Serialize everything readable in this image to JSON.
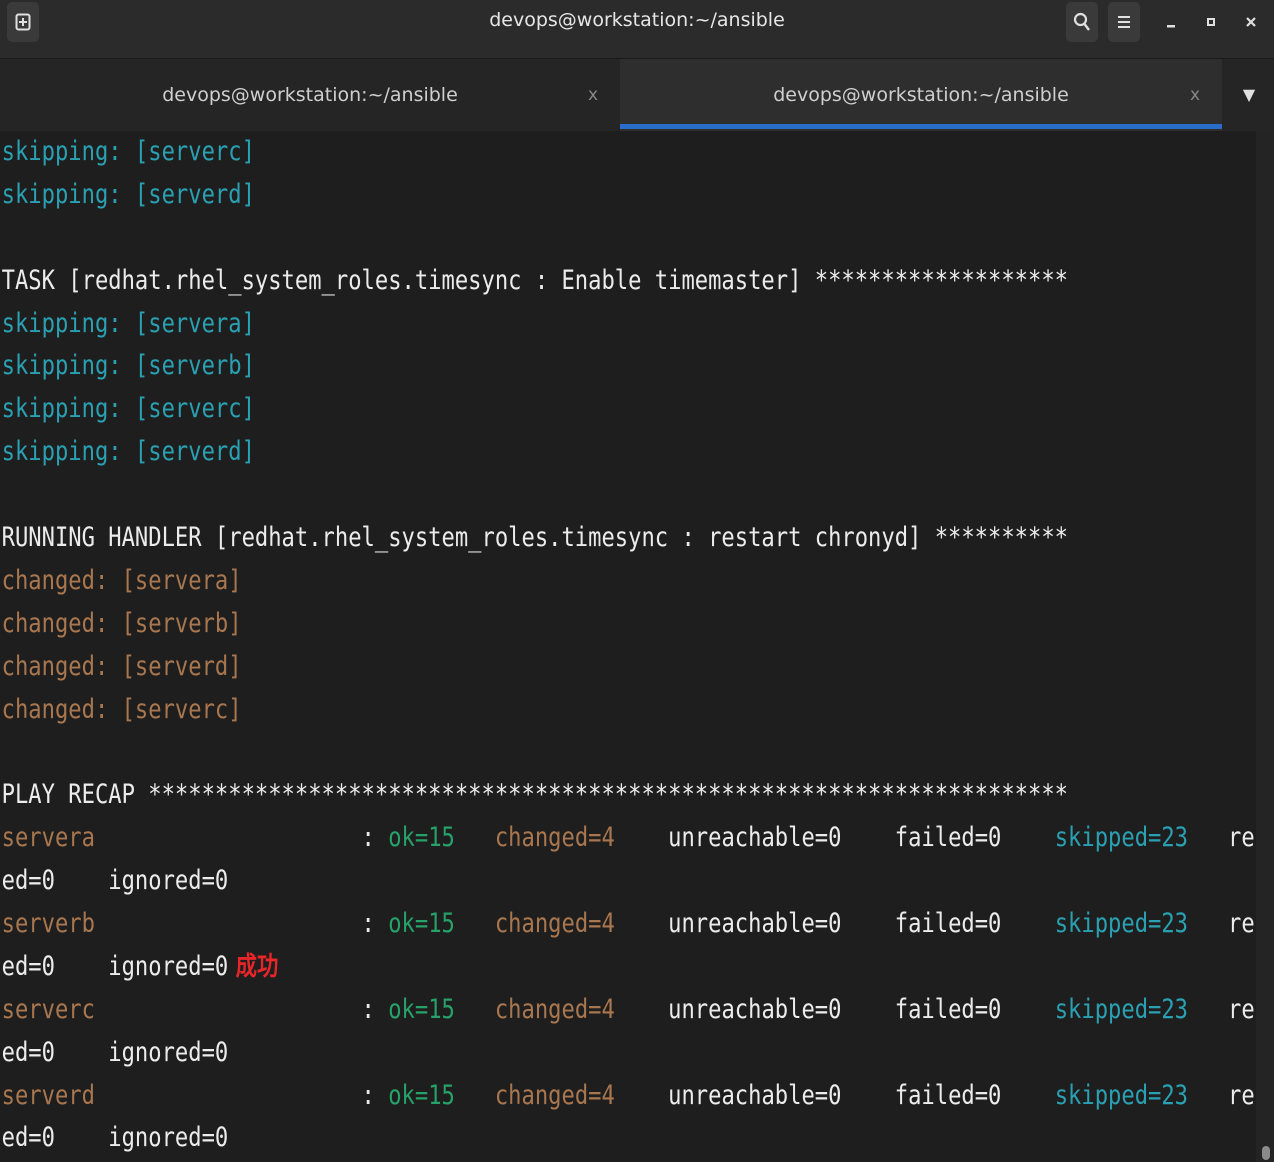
{
  "window": {
    "title": "devops@workstation:~/ansible"
  },
  "tabs": [
    {
      "label": "devops@workstation:~/ansible",
      "close": "x",
      "active": false
    },
    {
      "label": "devops@workstation:~/ansible",
      "close": "x",
      "active": true
    }
  ],
  "icons": {
    "new_tab": "new-tab-icon",
    "search": "search-icon",
    "menu": "hamburger-menu-icon",
    "minimize": "minimize-icon",
    "maximize": "maximize-icon",
    "close": "close-icon",
    "tab_list": "chevron-down-icon"
  },
  "colors": {
    "skipped": "#2aa1b3",
    "changed": "#a9774f",
    "ok": "#26a269",
    "annotation": "#e8262a",
    "active_tab_underline": "#2a6cc9"
  },
  "terminal": {
    "lines": [
      [
        {
          "t": "skipping: [serverc]",
          "c": "cyan"
        }
      ],
      [
        {
          "t": "skipping: [serverd]",
          "c": "cyan"
        }
      ],
      [],
      [
        {
          "t": "TASK [redhat.rhel_system_roles.timesync : Enable timemaster] *******************",
          "c": "white"
        }
      ],
      [
        {
          "t": "skipping: [servera]",
          "c": "cyan"
        }
      ],
      [
        {
          "t": "skipping: [serverb]",
          "c": "cyan"
        }
      ],
      [
        {
          "t": "skipping: [serverc]",
          "c": "cyan"
        }
      ],
      [
        {
          "t": "skipping: [serverd]",
          "c": "cyan"
        }
      ],
      [],
      [
        {
          "t": "RUNNING HANDLER [redhat.rhel_system_roles.timesync : restart chronyd] **********",
          "c": "white"
        }
      ],
      [
        {
          "t": "changed: [servera]",
          "c": "brown"
        }
      ],
      [
        {
          "t": "changed: [serverb]",
          "c": "brown"
        }
      ],
      [
        {
          "t": "changed: [serverd]",
          "c": "brown"
        }
      ],
      [
        {
          "t": "changed: [serverc]",
          "c": "brown"
        }
      ],
      [],
      [
        {
          "t": "PLAY RECAP *********************************************************************",
          "c": "white"
        }
      ],
      [
        {
          "t": "servera",
          "c": "brown"
        },
        {
          "t": "                    : ",
          "c": "white"
        },
        {
          "t": "ok=15",
          "c": "green"
        },
        {
          "t": "   ",
          "c": "white"
        },
        {
          "t": "changed=4",
          "c": "brown"
        },
        {
          "t": "    unreachable=0    failed=0    ",
          "c": "white"
        },
        {
          "t": "skipped=23",
          "c": "cyan"
        },
        {
          "t": "   rescu",
          "c": "white"
        }
      ],
      [
        {
          "t": "ed=0    ignored=0",
          "c": "white"
        }
      ],
      [
        {
          "t": "serverb",
          "c": "brown"
        },
        {
          "t": "                    : ",
          "c": "white"
        },
        {
          "t": "ok=15",
          "c": "green"
        },
        {
          "t": "   ",
          "c": "white"
        },
        {
          "t": "changed=4",
          "c": "brown"
        },
        {
          "t": "    unreachable=0    failed=0    ",
          "c": "white"
        },
        {
          "t": "skipped=23",
          "c": "cyan"
        },
        {
          "t": "   rescu",
          "c": "white"
        }
      ],
      [
        {
          "t": "ed=0    ignored=0",
          "c": "white"
        },
        {
          "t": " 成功",
          "c": "red"
        }
      ],
      [
        {
          "t": "serverc",
          "c": "brown"
        },
        {
          "t": "                    : ",
          "c": "white"
        },
        {
          "t": "ok=15",
          "c": "green"
        },
        {
          "t": "   ",
          "c": "white"
        },
        {
          "t": "changed=4",
          "c": "brown"
        },
        {
          "t": "    unreachable=0    failed=0    ",
          "c": "white"
        },
        {
          "t": "skipped=23",
          "c": "cyan"
        },
        {
          "t": "   rescu",
          "c": "white"
        }
      ],
      [
        {
          "t": "ed=0    ignored=0",
          "c": "white"
        }
      ],
      [
        {
          "t": "serverd",
          "c": "brown"
        },
        {
          "t": "                    : ",
          "c": "white"
        },
        {
          "t": "ok=15",
          "c": "green"
        },
        {
          "t": "   ",
          "c": "white"
        },
        {
          "t": "changed=4",
          "c": "brown"
        },
        {
          "t": "    unreachable=0    failed=0    ",
          "c": "white"
        },
        {
          "t": "skipped=23",
          "c": "cyan"
        },
        {
          "t": "   rescu",
          "c": "white"
        }
      ],
      [
        {
          "t": "ed=0    ignored=0",
          "c": "white"
        }
      ]
    ]
  }
}
